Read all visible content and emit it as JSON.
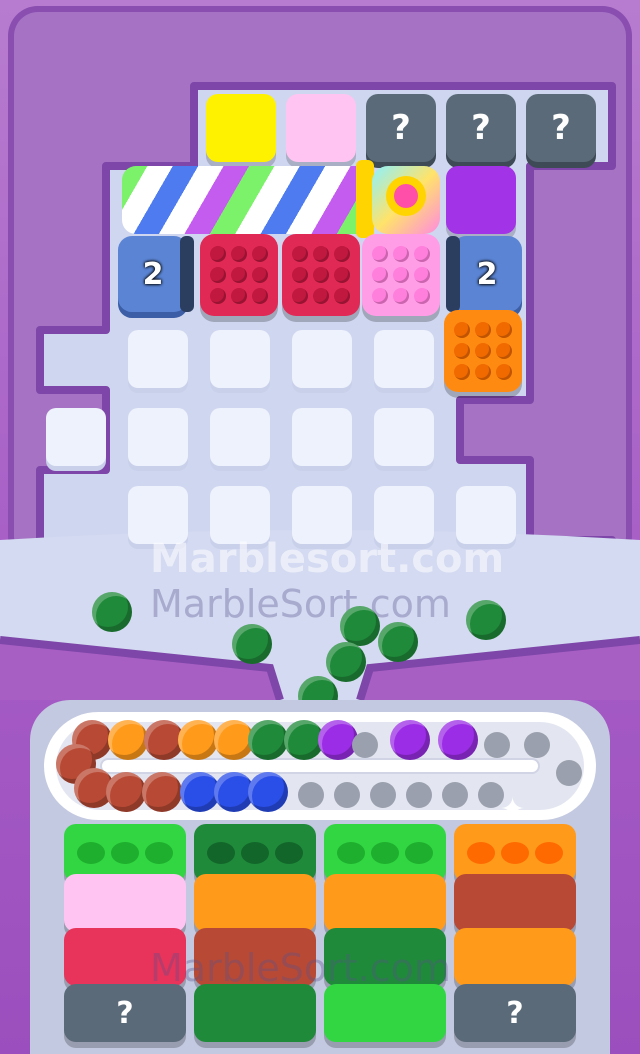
{
  "watermark": {
    "main": "Marblesort.com",
    "secondary": "MarbleSort.com",
    "bottom": "MarbleSort.com"
  },
  "board": {
    "top_row": [
      {
        "kind": "color",
        "color": "#fff200"
      },
      {
        "kind": "color",
        "color": "#ffc4f2"
      },
      {
        "kind": "mystery",
        "label": "?"
      },
      {
        "kind": "mystery",
        "label": "?"
      },
      {
        "kind": "mystery",
        "label": "?"
      }
    ],
    "rainbow_bar": {
      "colors": [
        "#7cf26a",
        "#ffffff",
        "#4e7cf0",
        "#ffffff",
        "#c45cf0"
      ],
      "cap_color": "#ff4fa8"
    },
    "purple_block": "#a233e6",
    "left_counter": "2",
    "right_counter": "2",
    "pop_tiles": [
      {
        "color": "#e02a55",
        "dot": "#c0183f"
      },
      {
        "color": "#e02a55",
        "dot": "#c0183f"
      },
      {
        "color": "#ff9ee6",
        "dot": "#ff7fdc"
      },
      {
        "color": "#ff8a12",
        "dot": "#f06a00"
      }
    ]
  },
  "falling_marbles": {
    "color": "#1f8a3a",
    "count": 9
  },
  "track": {
    "top_lane": [
      "#b84a35",
      "#ff9a1a",
      "#b84a35",
      "#ff9a1a",
      "#ff9a1a",
      "#1f8a3a",
      "#1f8a3a",
      "#9b2de6",
      "",
      "#9b2de6",
      "#9b2de6"
    ],
    "bottom_lane": [
      "#b84a35",
      "#b84a35",
      "#b84a35",
      "#b84a35",
      "#2a4ee8",
      "#2a4ee8",
      "#2a4ee8"
    ]
  },
  "jars": {
    "columns": [
      [
        {
          "color": "#31d642",
          "holes": "#1faf2e",
          "open": true
        },
        {
          "color": "#ffc4f2"
        },
        {
          "color": "#e8345a"
        },
        {
          "color": "#5a6a78",
          "label": "?"
        }
      ],
      [
        {
          "color": "#1f8a3a",
          "holes": "#12662a",
          "open": true
        },
        {
          "color": "#ff9a1a"
        },
        {
          "color": "#b84a35"
        },
        {
          "color": "#1f8a3a"
        }
      ],
      [
        {
          "color": "#31d642",
          "holes": "#1faf2e",
          "open": true
        },
        {
          "color": "#ff9a1a"
        },
        {
          "color": "#1f8a3a"
        },
        {
          "color": "#31d642"
        }
      ],
      [
        {
          "color": "#ff9a1a",
          "holes": "#ff6a00",
          "open": true
        },
        {
          "color": "#b84a35"
        },
        {
          "color": "#ff9a1a"
        },
        {
          "color": "#5a6a78",
          "label": "?"
        }
      ]
    ]
  }
}
